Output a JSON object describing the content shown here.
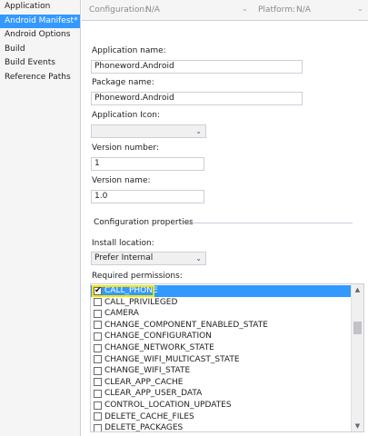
{
  "sidebar": {
    "items": [
      {
        "label": "Application"
      },
      {
        "label": "Android Manifest*"
      },
      {
        "label": "Android Options"
      },
      {
        "label": "Build"
      },
      {
        "label": "Build Events"
      },
      {
        "label": "Reference Paths"
      }
    ],
    "active_index": 1
  },
  "topbar": {
    "configuration_label": "Configuration:",
    "configuration_value": "N/A",
    "platform_label": "Platform:",
    "platform_value": "N/A"
  },
  "form": {
    "app_name_label": "Application name:",
    "app_name_value": "Phoneword.Android",
    "package_name_label": "Package name:",
    "package_name_value": "Phoneword.Android",
    "app_icon_label": "Application Icon:",
    "app_icon_value": "",
    "version_number_label": "Version number:",
    "version_number_value": "1",
    "version_name_label": "Version name:",
    "version_name_value": "1.0",
    "config_properties_title": "Configuration properties",
    "install_location_label": "Install location:",
    "install_location_value": "Prefer Internal",
    "required_permissions_label": "Required permissions:"
  },
  "permissions": {
    "items": [
      {
        "name": "CALL_PHONE",
        "checked": true,
        "selected": true
      },
      {
        "name": "CALL_PRIVILEGED",
        "checked": false
      },
      {
        "name": "CAMERA",
        "checked": false
      },
      {
        "name": "CHANGE_COMPONENT_ENABLED_STATE",
        "checked": false
      },
      {
        "name": "CHANGE_CONFIGURATION",
        "checked": false
      },
      {
        "name": "CHANGE_NETWORK_STATE",
        "checked": false
      },
      {
        "name": "CHANGE_WIFI_MULTICAST_STATE",
        "checked": false
      },
      {
        "name": "CHANGE_WIFI_STATE",
        "checked": false
      },
      {
        "name": "CLEAR_APP_CACHE",
        "checked": false
      },
      {
        "name": "CLEAR_APP_USER_DATA",
        "checked": false
      },
      {
        "name": "CONTROL_LOCATION_UPDATES",
        "checked": false
      },
      {
        "name": "DELETE_CACHE_FILES",
        "checked": false
      },
      {
        "name": "DELETE_PACKAGES",
        "checked": false
      }
    ]
  },
  "icons": {
    "dropdown_arrow": "chevron-down-icon",
    "checkmark": "checkmark-icon",
    "scroll_up": "scroll-up-arrow-icon",
    "scroll_down": "scroll-down-arrow-icon"
  },
  "colors": {
    "accent": "#3399ff",
    "focus_highlight": "#f2e600",
    "panel_bg": "#f5f5f5",
    "border": "#cccedb"
  }
}
